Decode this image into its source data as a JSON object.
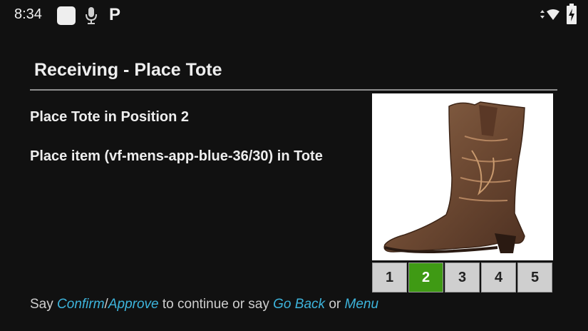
{
  "status_bar": {
    "time": "8:34",
    "p_label": "P",
    "icons": [
      "app-square-icon",
      "microphone-icon",
      "parking-icon",
      "wifi-signal-icon",
      "battery-charging-icon"
    ]
  },
  "screen": {
    "title": "Receiving - Place Tote",
    "instruction_position": "Place Tote in Position 2",
    "instruction_item": "Place item (vf-mens-app-blue-36/30) in Tote"
  },
  "product_image": {
    "subject": "brown leather cowboy boot"
  },
  "positions": {
    "labels": [
      "1",
      "2",
      "3",
      "4",
      "5"
    ],
    "active": "2",
    "active_color": "#3f9a14"
  },
  "footer": {
    "say": "Say",
    "confirm": "Confirm",
    "slash": "/",
    "approve": "Approve",
    "mid": "to continue or say",
    "go_back": "Go Back",
    "or": "or",
    "menu": "Menu"
  },
  "colors": {
    "background": "#111111",
    "keyword": "#3db4dc"
  }
}
